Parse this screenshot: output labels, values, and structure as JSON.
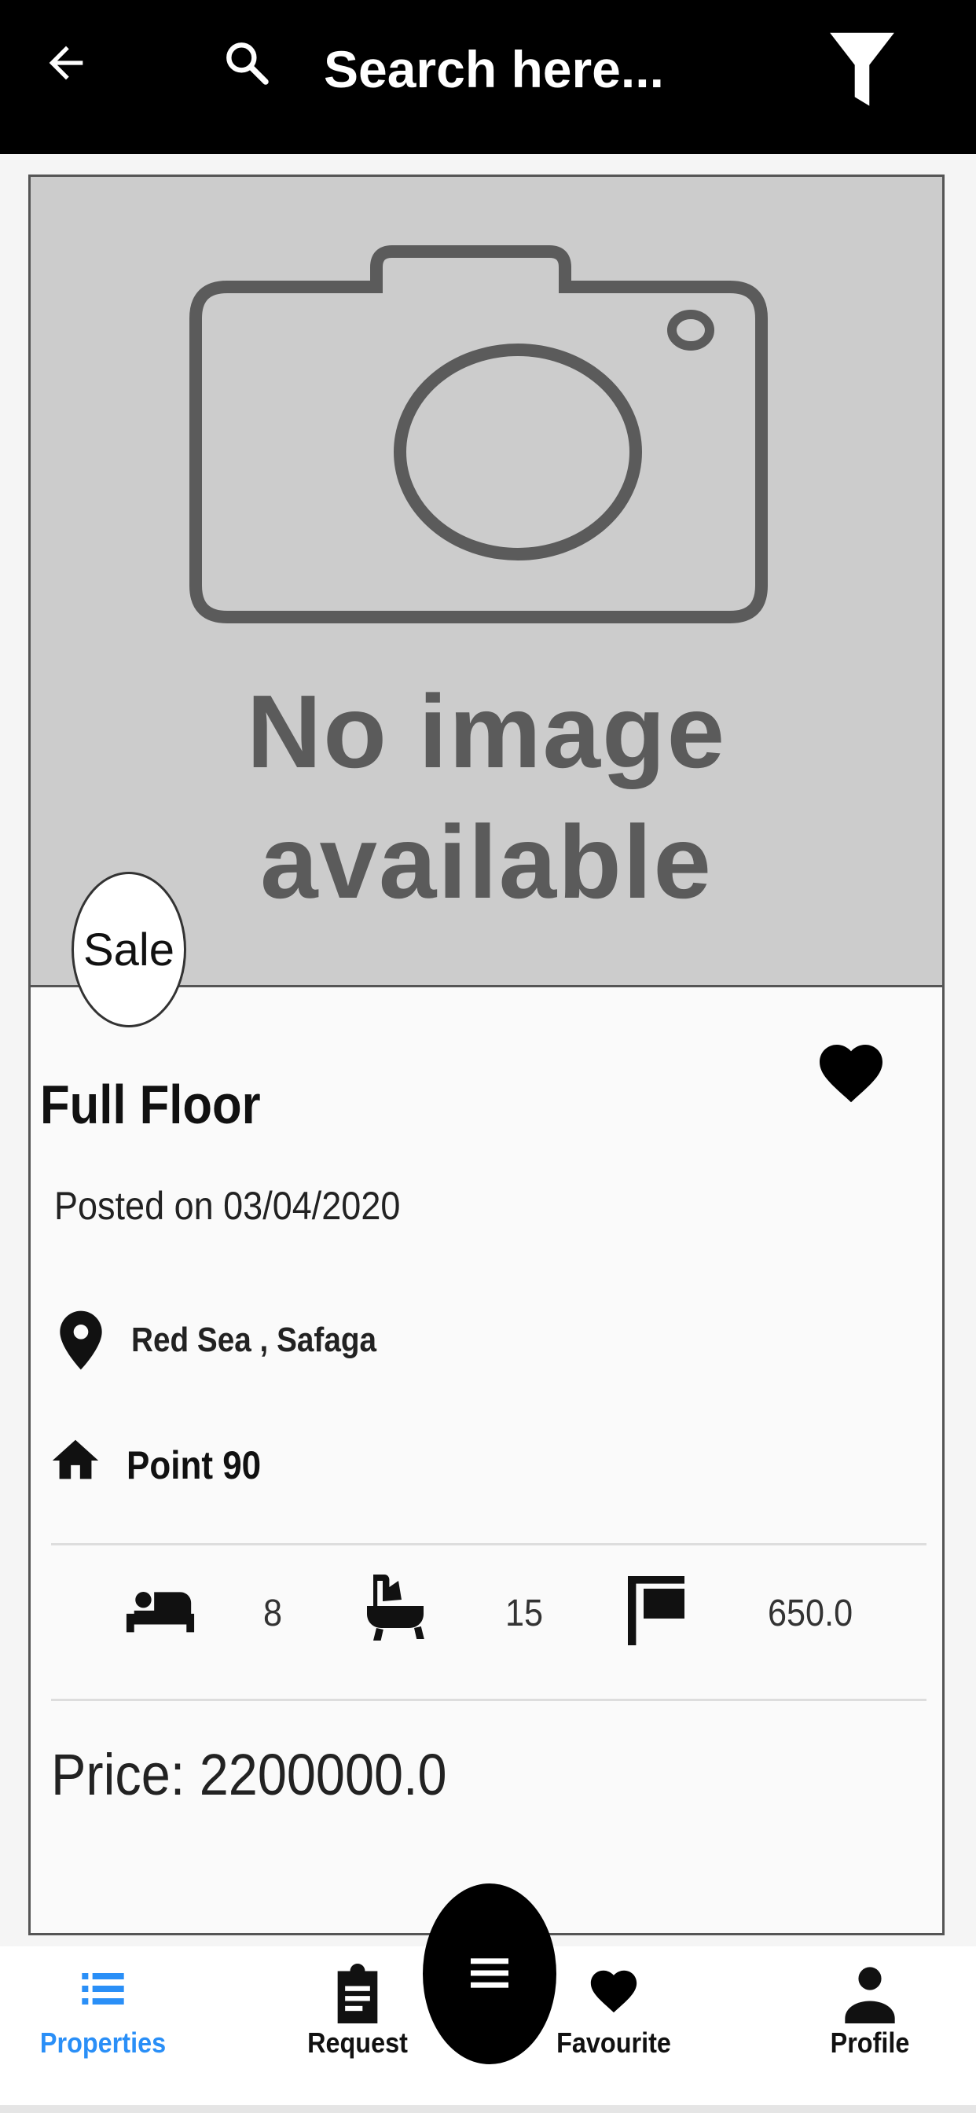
{
  "topbar": {
    "search_placeholder": "Search here..."
  },
  "listing": {
    "image_placeholder_line1": "No image",
    "image_placeholder_line2": "available",
    "badge": "Sale",
    "title": "Full Floor",
    "posted": "Posted on 03/04/2020",
    "location": "Red Sea , Safaga",
    "building": "Point 90",
    "bedrooms": "8",
    "bathrooms": "15",
    "area": "650.0",
    "price": "Price: 2200000.0",
    "favourite_icon": "heart-icon"
  },
  "bottom_nav": {
    "items": [
      {
        "label": "Properties",
        "icon": "list-icon",
        "active": true
      },
      {
        "label": "Request",
        "icon": "clipboard-icon",
        "active": false
      },
      {
        "label": "Favourite",
        "icon": "heart-icon",
        "active": false
      },
      {
        "label": "Profile",
        "icon": "person-icon",
        "active": false
      }
    ],
    "fab_icon": "menu-icon"
  },
  "colors": {
    "topbar": "#000000",
    "active_nav": "#2a8ff7",
    "placeholder_bg": "#cccccc"
  }
}
